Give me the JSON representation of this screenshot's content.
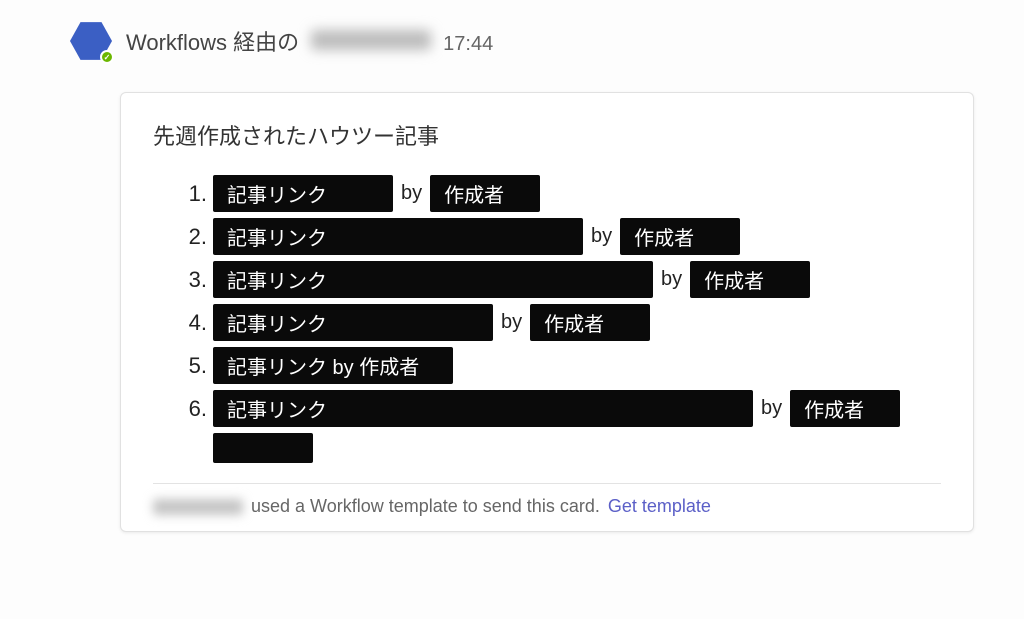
{
  "header": {
    "sender_prefix": "Workflows 経由の",
    "timestamp": "17:44"
  },
  "card": {
    "title": "先週作成されたハウツー記事",
    "items": [
      {
        "num": "1.",
        "link_label": "記事リンク",
        "by": "by",
        "author_label": "作成者",
        "inline": false
      },
      {
        "num": "2.",
        "link_label": "記事リンク",
        "by": "by",
        "author_label": "作成者",
        "inline": false
      },
      {
        "num": "3.",
        "link_label": "記事リンク",
        "by": "by",
        "author_label": "作成者",
        "inline": false
      },
      {
        "num": "4.",
        "link_label": "記事リンク",
        "by": "by",
        "author_label": "作成者",
        "inline": false
      },
      {
        "num": "5.",
        "link_label": "記事リンク by 作成者",
        "by": "",
        "author_label": "",
        "inline": true
      },
      {
        "num": "6.",
        "link_label": "記事リンク",
        "by": "by",
        "author_label": "作成者",
        "inline": false
      }
    ],
    "footer_text": "used a Workflow template to send this card.",
    "footer_link": "Get template"
  }
}
